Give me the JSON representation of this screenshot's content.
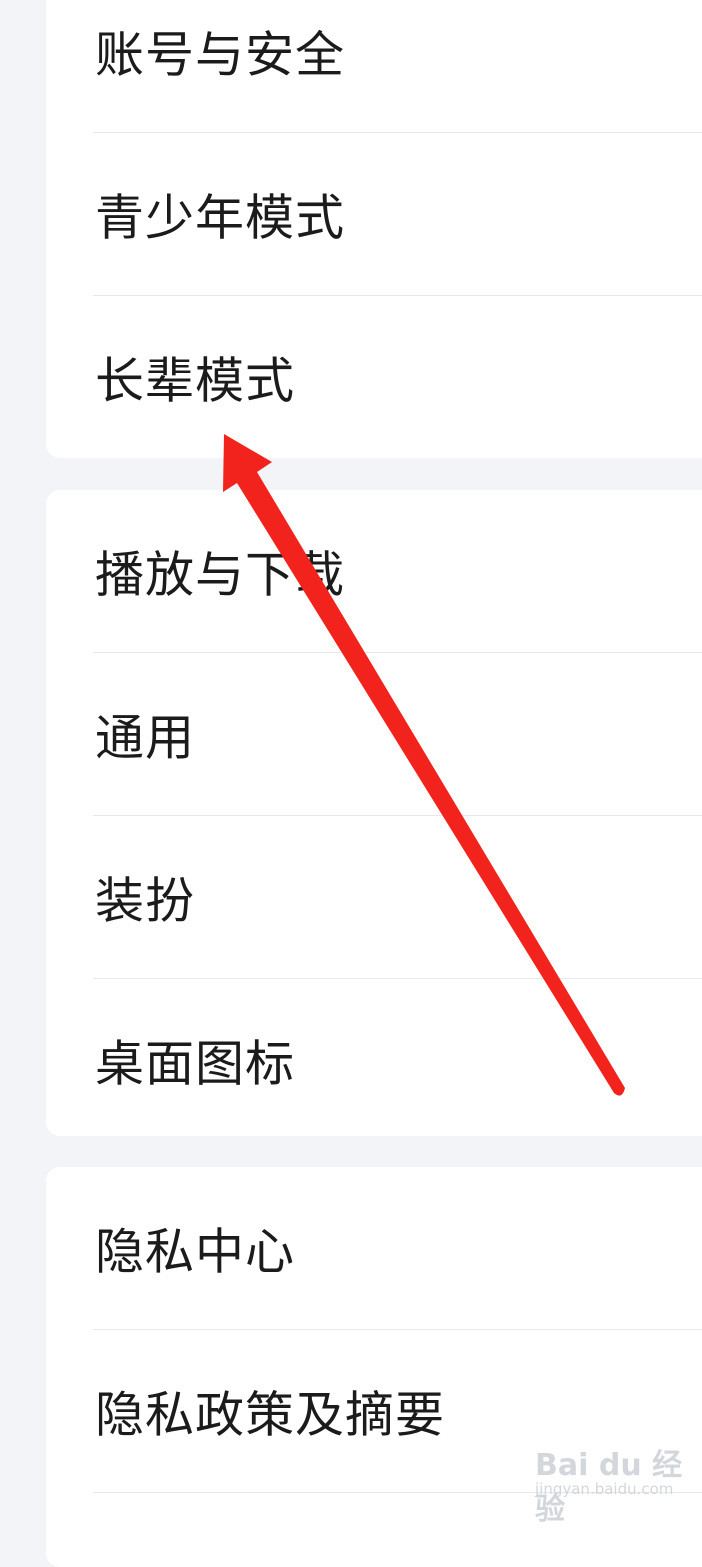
{
  "sections": [
    {
      "items": [
        {
          "label": "账号与安全"
        },
        {
          "label": "青少年模式"
        },
        {
          "label": "长辈模式"
        }
      ]
    },
    {
      "items": [
        {
          "label": "播放与下载"
        },
        {
          "label": "通用"
        },
        {
          "label": "装扮"
        },
        {
          "label": "桌面图标"
        }
      ]
    },
    {
      "items": [
        {
          "label": "隐私中心"
        },
        {
          "label": "隐私政策及摘要"
        }
      ]
    }
  ],
  "annotation": {
    "arrow_color": "#f2231d"
  },
  "watermark": {
    "logo_text": "Bai du 经验",
    "url_text": "jingyan.baidu.com"
  }
}
